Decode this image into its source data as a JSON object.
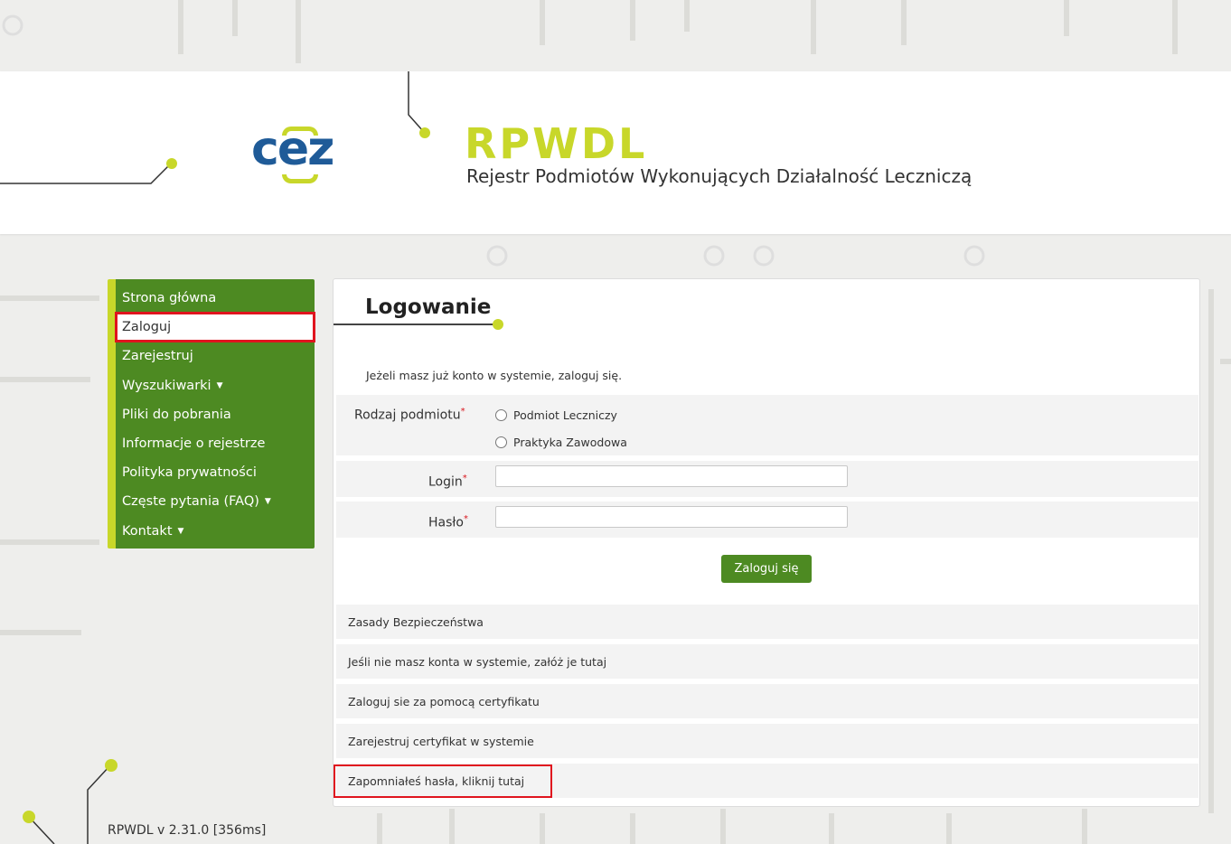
{
  "header": {
    "logo_text": "cez",
    "title": "RPWDL",
    "subtitle": "Rejestr Podmiotów Wykonujących Działalność Leczniczą"
  },
  "sidebar": {
    "items": [
      {
        "label": "Strona główna",
        "has_caret": false
      },
      {
        "label": "Zaloguj",
        "has_caret": false,
        "active": true
      },
      {
        "label": "Zarejestruj",
        "has_caret": false
      },
      {
        "label": "Wyszukiwarki",
        "has_caret": true
      },
      {
        "label": "Pliki do pobrania",
        "has_caret": false
      },
      {
        "label": "Informacje o rejestrze",
        "has_caret": false
      },
      {
        "label": "Polityka prywatności",
        "has_caret": false
      },
      {
        "label": "Częste pytania (FAQ)",
        "has_caret": true
      },
      {
        "label": "Kontakt",
        "has_caret": true
      }
    ]
  },
  "login": {
    "title": "Logowanie",
    "intro": "Jeżeli masz już konto w systemie, zaloguj się.",
    "entity_type_label": "Rodzaj podmiotu",
    "entity_options": [
      "Podmiot Leczniczy",
      "Praktyka Zawodowa"
    ],
    "login_label": "Login",
    "login_value": "",
    "password_label": "Hasło",
    "password_value": "",
    "submit_label": "Zaloguj się",
    "links": [
      "Zasady Bezpieczeństwa",
      "Jeśli nie masz konta w systemie, załóż je tutaj",
      "Zaloguj sie za pomocą certyfikatu",
      "Zarejestruj certyfikat w systemie",
      "Zapomniałeś hasła, kliknij tutaj"
    ]
  },
  "footer": {
    "version": "RPWDL v 2.31.0 [356ms]"
  },
  "colors": {
    "accent_green": "#4d8a22",
    "accent_lime": "#c8d72a",
    "logo_blue": "#1f5b98",
    "highlight_red": "#e0141e"
  },
  "icons": {
    "caret": "caret-down-icon",
    "radio": "radio-unchecked-icon"
  }
}
